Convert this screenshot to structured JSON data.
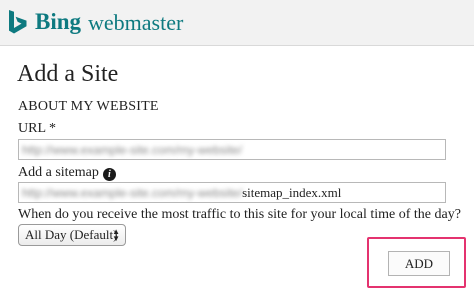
{
  "header": {
    "brand": "Bing",
    "product": "webmaster",
    "logo_icon": "bing-logo-icon",
    "accent": "#0e7a80"
  },
  "page_title": "Add a Site",
  "section_title": "ABOUT MY WEBSITE",
  "url_field": {
    "label": "URL *",
    "value_blurred": "http://www.example-site.com/my-website/"
  },
  "sitemap_field": {
    "label": "Add a sitemap",
    "info_icon": "info-icon",
    "value_blurred": "http://www.example-site.com/my-website/",
    "value_suffix": "sitemap_index.xml"
  },
  "traffic_question": {
    "label": "When do you receive the most traffic to this site for your local time of the day?",
    "info_icon": "info-icon"
  },
  "traffic_select": {
    "selected": "All Day (Default)"
  },
  "add_button": {
    "label": "ADD",
    "highlight_color": "#e4336f"
  }
}
